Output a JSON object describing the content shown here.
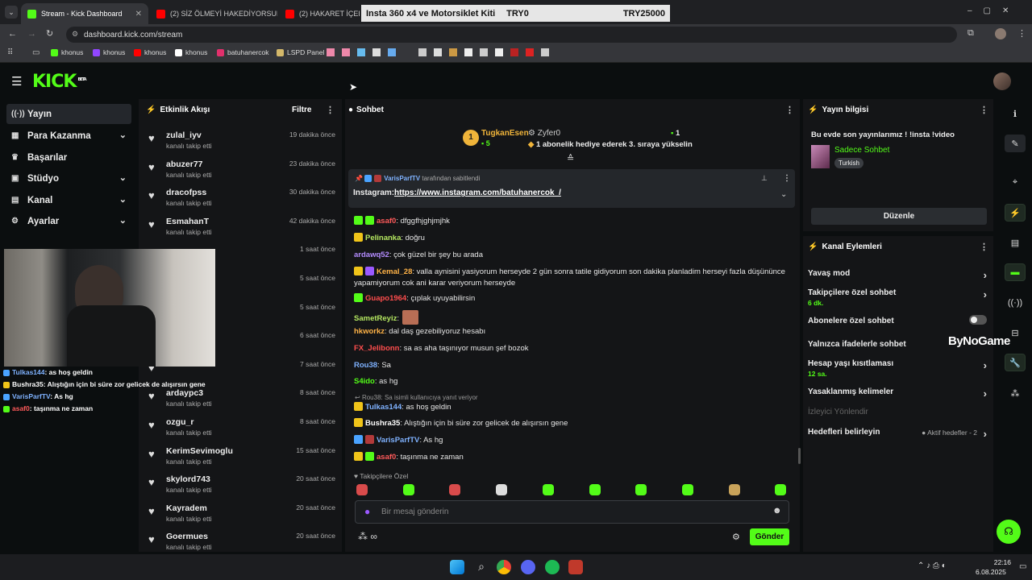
{
  "browser": {
    "tabs": [
      {
        "title": "Stream - Kick Dashboard",
        "color": "#53fc18"
      },
      {
        "title": "(2) SİZ ÖLMEYİ HAKEDİYORSUN",
        "color": "#ff0000"
      },
      {
        "title": "(2) HAKARET İÇERİRİ Tu",
        "color": "#ff0000"
      }
    ],
    "price_overlay": {
      "item": "Insta 360 x4 ve Motorsiklet Kiti",
      "start": "TRY0",
      "goal": "TRY25000"
    },
    "url": "dashboard.kick.com/stream",
    "bookmarks": [
      "khonus",
      "khonus",
      "khonus",
      "khonus",
      "batuhanercok",
      "LSPD Panel"
    ]
  },
  "kick": {
    "logo": "KICK",
    "beta": "BETA"
  },
  "nav": [
    {
      "label": "Yayın",
      "icon": "((·))",
      "selected": true
    },
    {
      "label": "Para Kazanma",
      "icon": "▦",
      "chevron": "⌄"
    },
    {
      "label": "Başarılar",
      "icon": "🏆"
    },
    {
      "label": "Stüdyo",
      "icon": "▣",
      "chevron": "⌄"
    },
    {
      "label": "Kanal",
      "icon": "▤",
      "chevron": "⌄"
    },
    {
      "label": "Ayarlar",
      "icon": "⚙",
      "chevron": "⌄"
    }
  ],
  "activity": {
    "title": "Etkinlik Akışı",
    "filter": "Filtre",
    "items": [
      {
        "name": "zulal_iyv",
        "sub": "kanalı takip etti",
        "time": "19 dakika önce"
      },
      {
        "name": "abuzer77",
        "sub": "kanalı takip etti",
        "time": "23 dakika önce"
      },
      {
        "name": "dracofpss",
        "sub": "kanalı takip etti",
        "time": "30 dakika önce"
      },
      {
        "name": "EsmahanT",
        "sub": "kanalı takip etti",
        "time": "42 dakika önce"
      },
      {
        "name": "",
        "sub": "",
        "time": "1 saat önce"
      },
      {
        "name": "",
        "sub": "",
        "time": "5 saat önce"
      },
      {
        "name": "",
        "sub": "",
        "time": "5 saat önce"
      },
      {
        "name": "",
        "sub": "",
        "time": "6 saat önce"
      },
      {
        "name": "",
        "sub": "",
        "time": "7 saat önce"
      },
      {
        "name": "ardaypc3",
        "sub": "kanalı takip etti",
        "time": "8 saat önce"
      },
      {
        "name": "ozgu_r",
        "sub": "kanalı takip etti",
        "time": "8 saat önce"
      },
      {
        "name": "KerimSevimoglu",
        "sub": "kanalı takip etti",
        "time": "15 saat önce"
      },
      {
        "name": "skylord743",
        "sub": "kanalı takip etti",
        "time": "20 saat önce"
      },
      {
        "name": "Kayradem",
        "sub": "kanalı takip etti",
        "time": "20 saat önce"
      },
      {
        "name": "Goermues",
        "sub": "kanalı takip etti",
        "time": "20 saat önce"
      }
    ]
  },
  "overlay_chat": [
    {
      "user": "Tulkas144",
      "text": ": as hoş geldin",
      "color": "#7fb2ff"
    },
    {
      "user": "Bushra35",
      "text": ": Alıştığın için bi süre zor gelicek de alışırsın gene",
      "color": "#ffffff"
    },
    {
      "user": "VarisParfTV",
      "text": ": As hg",
      "color": "#7fb2ff"
    },
    {
      "user": "asaf0",
      "text": ": taşınma ne zaman",
      "color": "#ff5a5a"
    }
  ],
  "chat": {
    "title": "Sohbet",
    "top_gifter": {
      "rank": "1",
      "name": "TugkanEsen",
      "count": "5"
    },
    "gift_user": "Zyfer0",
    "gift_count": "1",
    "gift_text": "1 abonelik hediye ederek 3. sıraya yükselin",
    "pinned": {
      "by_user": "VarisParfTV",
      "by_text": "tarafından sabitlendi",
      "label": "Instagram:",
      "link": "https://www.instagram.com/batuhanercok_/"
    },
    "messages": [
      {
        "user": "asaf0",
        "text": ": dfggfhjghjmjhk",
        "color": "#ff5a5a"
      },
      {
        "user": "Pelinanka",
        "text": ": doğru",
        "color": "#b5e861"
      },
      {
        "user": "ardawq52",
        "text": ": çok güzel bir şey bu arada",
        "color": "#b48cff"
      },
      {
        "user": "Kemal_28",
        "text": ": valla aynisini yasiyorum herseyde 2 gün sonra tatile gidiyorum son dakika planladim herseyi fazla düşününce yapamiyorum cok ani karar veriyorum herseyde",
        "color": "#ffb347"
      },
      {
        "user": "Guapo1964",
        "text": ": çıplak uyuyabilirsin",
        "color": "#ff4d4d"
      },
      {
        "user": "SametReyiz",
        "text": ":",
        "color": "#b5e861"
      },
      {
        "user": "hkworkz",
        "text": ": dal daş gezebiliyoruz hesabı",
        "color": "#ffb347"
      },
      {
        "user": "FX_Jelibonn",
        "text": ": sa as aha taşınıyor musun şef bozok",
        "color": "#ff4d4d"
      },
      {
        "user": "Rou38",
        "text": ": Sa",
        "color": "#7fb2ff"
      },
      {
        "user": "S4ido",
        "text": ": as hg",
        "color": "#53fc18"
      },
      {
        "user": "Tulkas144",
        "text": ": as hoş geldin",
        "color": "#7fb2ff"
      },
      {
        "user": "Bushra35",
        "text": ": Alıştığın için bi süre zor gelicek de alışırsın gene",
        "color": "#ffffff"
      },
      {
        "user": "VarisParfTV",
        "text": ": As hg",
        "color": "#7fb2ff"
      },
      {
        "user": "asaf0",
        "text": ": taşınma ne zaman",
        "color": "#ff5a5a"
      }
    ],
    "reply_note": "Rou38: Sa isimli kullanıcıya yanıt veriyor",
    "emote_section": "Takipçilere Özel",
    "input_placeholder": "Bir mesaj gönderin",
    "send": "Gönder"
  },
  "stream_info": {
    "title": "Yayın bilgisi",
    "stream_title": "Bu evde son yayınlarımız ! !insta !video",
    "category": "Sadece Sohbet",
    "language": "Turkish",
    "edit": "Düzenle"
  },
  "channel_actions": {
    "title": "Kanal Eylemleri",
    "items": [
      {
        "label": "Yavaş mod",
        "sub": "",
        "arrow": "›"
      },
      {
        "label": "Takipçilere özel sohbet",
        "sub": "6 dk.",
        "arrow": "›"
      },
      {
        "label": "Abonelere özel sohbet",
        "sub": "",
        "toggle": true
      },
      {
        "label": "Yalnızca ifadelerle sohbet",
        "sub": ""
      },
      {
        "label": "Hesap yaşı kısıtlaması",
        "sub": "12 sa.",
        "arrow": "›"
      },
      {
        "label": "Yasaklanmış kelimeler",
        "sub": "",
        "arrow": "›"
      },
      {
        "label": "İzleyici Yönlendir",
        "sub": "",
        "disabled": true
      },
      {
        "label": "Hedefleri belirleyin",
        "sub": "",
        "right": "● Aktif hedefler - 2",
        "arrow": "›"
      }
    ]
  },
  "watermark": "ByNoGame",
  "clock": {
    "time": "22:16",
    "date": "6.08.2025"
  }
}
